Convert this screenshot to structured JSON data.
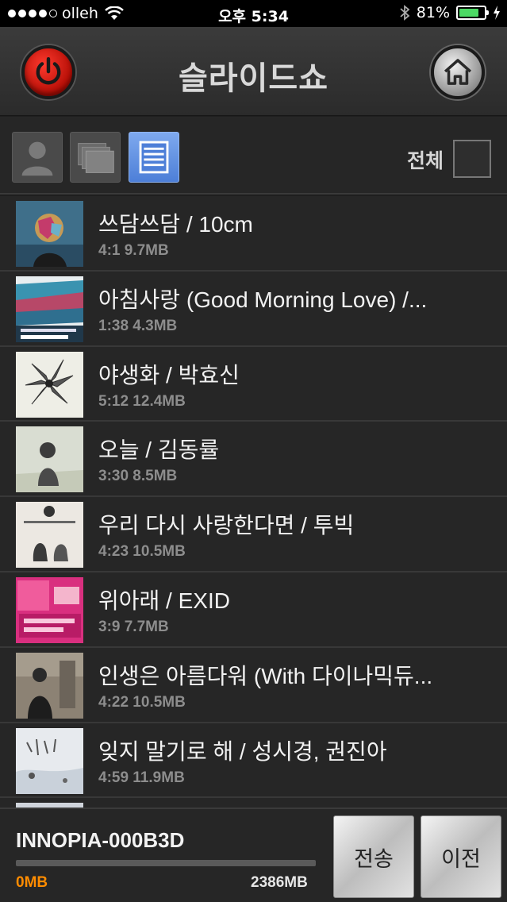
{
  "status_bar": {
    "carrier": "olleh",
    "time": "오후 5:34",
    "battery": "81%",
    "battery_level": 0.81
  },
  "header": {
    "title": "슬라이드쇼",
    "power_icon": "power-icon",
    "home_icon": "home-icon"
  },
  "filter": {
    "tabs": [
      {
        "icon": "person-icon",
        "selected": false
      },
      {
        "icon": "folder-icon",
        "selected": false
      },
      {
        "icon": "list-icon",
        "selected": true
      }
    ],
    "select_all_label": "전체"
  },
  "songs": [
    {
      "title": "쓰담쓰담 / 10cm",
      "meta": "4:1 9.7MB"
    },
    {
      "title": "아침사랑 (Good Morning Love) /...",
      "meta": "1:38 4.3MB"
    },
    {
      "title": "야생화 / 박효신",
      "meta": "5:12 12.4MB"
    },
    {
      "title": "오늘 / 김동률",
      "meta": "3:30 8.5MB"
    },
    {
      "title": "우리 다시 사랑한다면 / 투빅",
      "meta": "4:23 10.5MB"
    },
    {
      "title": "위아래 / EXID",
      "meta": "3:9 7.7MB"
    },
    {
      "title": "인생은 아름다워 (With 다이나믹듀...",
      "meta": "4:22 10.5MB"
    },
    {
      "title": "잊지 말기로 해 / 성시경, 권진아",
      "meta": "4:59 11.9MB"
    }
  ],
  "footer": {
    "device_name": "INNOPIA-000B3D",
    "used": "0MB",
    "total": "2386MB",
    "progress": 0,
    "send_label": "전송",
    "prev_label": "이전"
  },
  "colors": {
    "accent": "#ff8c00",
    "power_red": "#e0160c",
    "tab_selected": "#5b8be0"
  }
}
